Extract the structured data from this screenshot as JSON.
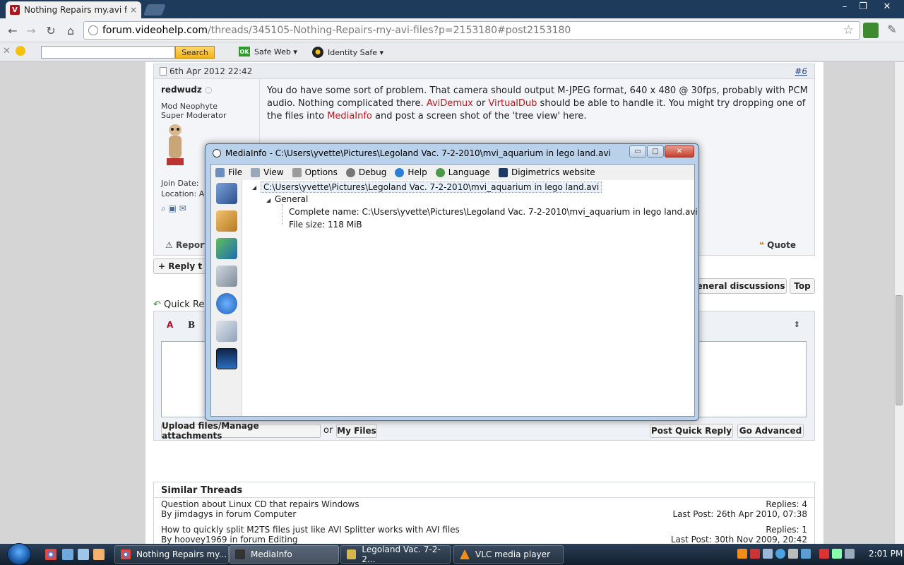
{
  "browser": {
    "tab_title": "Nothing Repairs my.avi files",
    "tab_close": "×",
    "url_domain": "forum.videohelp.com",
    "url_path": "/threads/345105-Nothing-Repairs-my-avi-files?p=2153180#post2153180",
    "window_controls": [
      "–",
      "❐",
      "✕"
    ]
  },
  "norton": {
    "search_label": "Search",
    "safe_web": "Safe Web ▾",
    "safe_web_badge": "OK",
    "identity_safe": "Identity Safe ▾"
  },
  "post": {
    "date": "6th Apr 2012 22:42",
    "number": "#6",
    "username": "redwudz",
    "user_title_1": "Mod Neophyte",
    "user_title_2": "Super Moderator",
    "join_label": "Join Date:",
    "location_label": "Location: A",
    "text_1": "You do have some sort of problem. That camera should output M-JPEG format, 640 x 480 @ 30fps, probably with PCM audio. Nothing complicated there. ",
    "link_avidemux": "AviDemux",
    "text_or": " or ",
    "link_virtualdub": "VirtualDub",
    "text_2": " should be able to handle it. You might try dropping one of the files into ",
    "link_mediainfo": "MediaInfo",
    "text_3": " and post a screen shot of the 'tree view' here.",
    "report_label": "Report",
    "quote_label": "Quote"
  },
  "actions": {
    "reply": "+ Reply t",
    "general": "eneral discussions",
    "top": "Top",
    "quick_reply": "Quick Re",
    "upload": "Upload files/Manage attachments",
    "or": "or",
    "my_files": "My Files",
    "post_quick_reply": "Post Quick Reply",
    "go_advanced": "Go Advanced",
    "bold": "B"
  },
  "similar": {
    "heading": "Similar Threads",
    "threads": [
      {
        "title": "Question about Linux CD that repairs Windows",
        "by": "By jimdagys in forum Computer",
        "replies": "Replies: 4",
        "last_post": "Last Post: 26th Apr 2010, 07:38"
      },
      {
        "title": "How to quickly split M2TS files just like AVI Splitter works with AVI files",
        "by": "By hoovey1969 in forum Editing",
        "replies": "Replies: 1",
        "last_post": "Last Post: 30th Nov 2009, 20:42"
      }
    ]
  },
  "mediainfo": {
    "title": "MediaInfo - C:\\Users\\yvette\\Pictures\\Legoland Vac. 7-2-2010\\mvi_aquarium in lego land.avi",
    "menu": [
      "File",
      "View",
      "Options",
      "Debug",
      "Help",
      "Language",
      "Digimetrics website"
    ],
    "root": "C:\\Users\\yvette\\Pictures\\Legoland Vac. 7-2-2010\\mvi_aquarium in lego land.avi",
    "section": "General",
    "complete_name": "Complete name: C:\\Users\\yvette\\Pictures\\Legoland Vac. 7-2-2010\\mvi_aquarium in lego land.avi",
    "file_size": "File size: 118 MiB"
  },
  "taskbar": {
    "items": [
      "Nothing Repairs my...",
      "MediaInfo",
      "Legoland Vac. 7-2-2...",
      "VLC media player"
    ],
    "clock": "2:01 PM"
  },
  "colors": {
    "accent_link": "#c0171a",
    "title_bar": "#1f3b5b",
    "search_button": "#f3b21b"
  }
}
